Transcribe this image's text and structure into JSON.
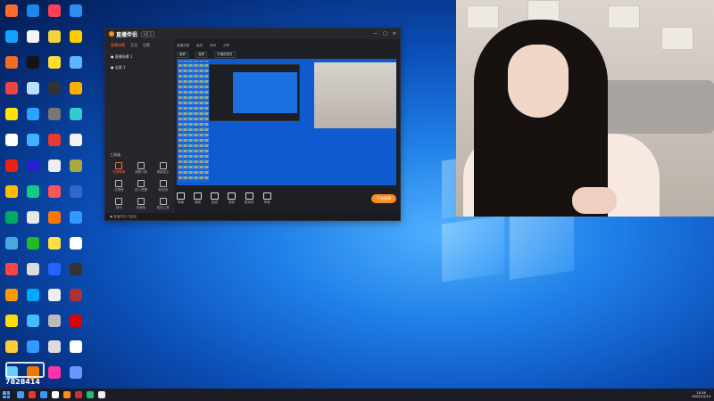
{
  "desktop": {
    "watermark_id": "7828414",
    "icon_rows": [
      [
        "#ff6b2b",
        "#1a88e8",
        "#ff3f5a",
        "#2f8df2"
      ],
      [
        "#12a4ff",
        "#f5f5f5",
        "#f0d43c",
        "#ffcc00"
      ],
      [
        "#f46c23",
        "#141414",
        "#ffdd2e",
        "#5db7ff"
      ],
      [
        "#e44",
        "#b8e2ff",
        "#333",
        "#ffb000"
      ],
      [
        "#ffe400",
        "#2aa2ff",
        "#777",
        "#3cc"
      ],
      [
        "#ffffff",
        "#3fb3ff",
        "#e53b2f",
        "#f2f2f2"
      ],
      [
        "#e21",
        "#22c",
        "#eee",
        "#aa4"
      ],
      [
        "#fb0",
        "#1c8",
        "#f55",
        "#36c"
      ],
      [
        "#0a6",
        "#e6e6e6",
        "#f70",
        "#39f"
      ],
      [
        "#4ad",
        "#2b2",
        "#fd4",
        "#fff"
      ],
      [
        "#f44",
        "#ddd",
        "#26f",
        "#333"
      ],
      [
        "#f90",
        "#0af",
        "#eee",
        "#a33"
      ],
      [
        "#fd0",
        "#4bf",
        "#bbb",
        "#d00"
      ],
      [
        "#fc3",
        "#39f",
        "#ddd",
        "#fff"
      ],
      [
        "#6cf",
        "#e70",
        "#f3a",
        "#69f"
      ]
    ]
  },
  "app": {
    "name": "直播伴侣",
    "version": "V5.1",
    "window_controls": [
      "—",
      "□",
      "✕"
    ],
    "sidebar_tabs": [
      "直播场景",
      "互动",
      "设置"
    ],
    "scenes": [
      "● 直播场景 1",
      "● 全屏 1"
    ],
    "tools_title": "工具箱",
    "tools": [
      "礼物特效",
      "观看人数",
      "弹幕显示",
      "礼物榜",
      "进入提醒",
      "粉丝团",
      "音乐",
      "背景板",
      "更多工具"
    ],
    "tools_active_index": 0,
    "toolbar2": [
      "直播设置",
      "画质",
      "房间",
      "分享"
    ],
    "toolbar3": [
      "横屏",
      "竖屏",
      "开播前预览"
    ],
    "controls": [
      "场景",
      "美颜",
      "贴纸",
      "录制",
      "麦克风",
      "声音"
    ],
    "start_button": "开始直播",
    "status_text": "●  直播伴侣·已就绪"
  },
  "taskbar": {
    "apps": [
      "#3ba0ff",
      "#e33",
      "#39f",
      "#fff",
      "#ff8a1f",
      "#c33",
      "#2b7",
      "#eee"
    ],
    "clock_time": "10:16",
    "clock_date": "2022/12/13"
  }
}
